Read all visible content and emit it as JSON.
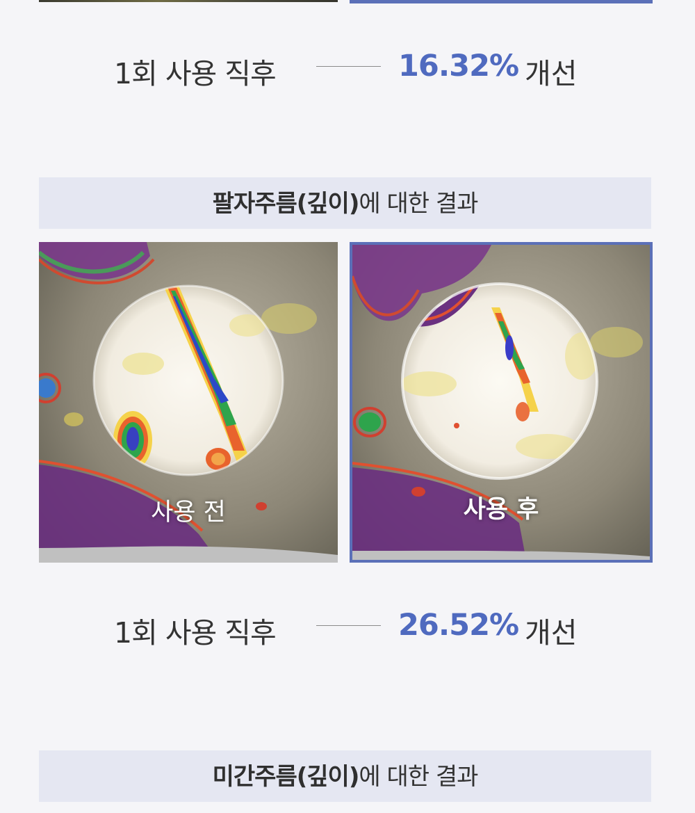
{
  "results": [
    {
      "label": "1회 사용 직후",
      "percent": "16.32%",
      "word": "개선"
    },
    {
      "label": "1회 사용 직후",
      "percent": "26.52%",
      "word": "개선"
    }
  ],
  "sections": [
    {
      "title_strong": "팔자주름(깊이)",
      "title_rest": "에 대한 결과"
    },
    {
      "title_strong": "미간주름(깊이)",
      "title_rest": "에 대한 결과"
    }
  ],
  "photos": {
    "before_caption": "사용 전",
    "after_caption": "사용 후"
  },
  "colors": {
    "accent": "#4f6abf",
    "frame": "#5b70b8",
    "header_bg": "#e5e7f2",
    "page_bg": "#f5f5f8"
  }
}
